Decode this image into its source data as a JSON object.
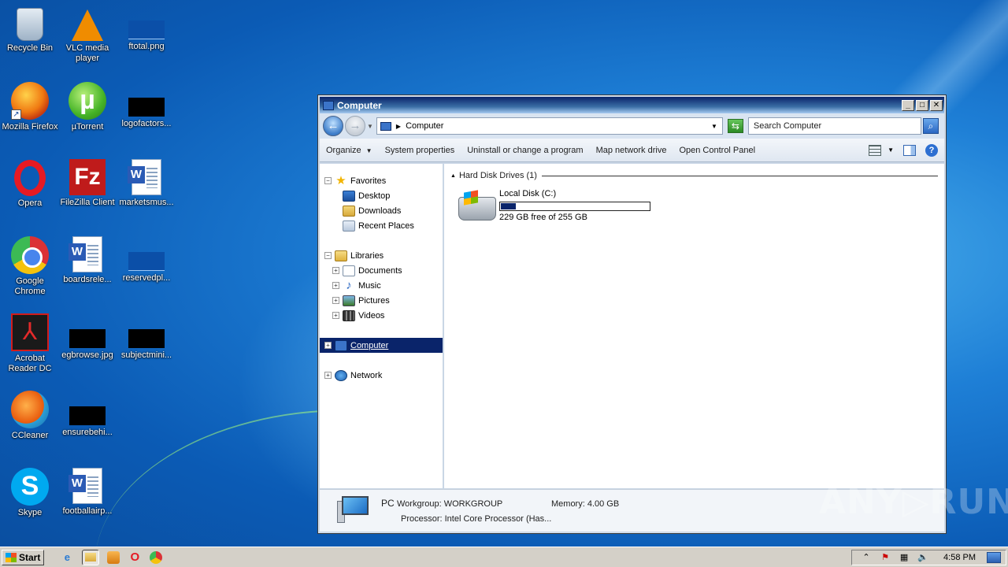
{
  "desktop": {
    "icons": [
      {
        "label": "Recycle Bin",
        "icon": "recycle-bin-icon"
      },
      {
        "label": "VLC media player",
        "icon": "vlc-icon"
      },
      {
        "label": "ftotal.png",
        "icon": "image-file-icon"
      },
      {
        "label": "Mozilla Firefox",
        "icon": "firefox-icon"
      },
      {
        "label": "µTorrent",
        "icon": "utorrent-icon"
      },
      {
        "label": "logofactors...",
        "icon": "image-file-icon"
      },
      {
        "label": "Opera",
        "icon": "opera-icon"
      },
      {
        "label": "FileZilla Client",
        "icon": "filezilla-icon"
      },
      {
        "label": "marketsmus...",
        "icon": "word-document-icon"
      },
      {
        "label": "Google Chrome",
        "icon": "chrome-icon"
      },
      {
        "label": "boardsrele...",
        "icon": "word-document-icon"
      },
      {
        "label": "reservedpl...",
        "icon": "image-file-icon"
      },
      {
        "label": "Acrobat Reader DC",
        "icon": "acrobat-icon"
      },
      {
        "label": "egbrowse.jpg",
        "icon": "image-file-icon"
      },
      {
        "label": "subjectmini...",
        "icon": "image-file-icon"
      },
      {
        "label": "CCleaner",
        "icon": "ccleaner-icon"
      },
      {
        "label": "ensurebehi...",
        "icon": "image-file-icon"
      },
      {
        "label": "Skype",
        "icon": "skype-icon"
      },
      {
        "label": "footballairp...",
        "icon": "word-document-icon"
      }
    ]
  },
  "window": {
    "title": "Computer",
    "buttons": {
      "minimize": "_",
      "maximize": "□",
      "close": "✕"
    },
    "address": {
      "crumb": "Computer"
    },
    "search": {
      "placeholder": "Search Computer"
    },
    "toolbar": {
      "organize": "Organize",
      "system_properties": "System properties",
      "uninstall": "Uninstall or change a program",
      "map_drive": "Map network drive",
      "control_panel": "Open Control Panel"
    },
    "nav": {
      "favorites": "Favorites",
      "desktop": "Desktop",
      "downloads": "Downloads",
      "recent": "Recent Places",
      "libraries": "Libraries",
      "documents": "Documents",
      "music": "Music",
      "pictures": "Pictures",
      "videos": "Videos",
      "computer": "Computer",
      "network": "Network"
    },
    "content": {
      "group_title": "Hard Disk Drives (1)",
      "drive_name": "Local Disk (C:)",
      "drive_free": "229 GB free of 255 GB",
      "drive_used_fraction": 0.102
    },
    "details": {
      "name": "PC",
      "workgroup": "Workgroup: WORKGROUP",
      "memory": "Memory: 4.00 GB",
      "processor": "Processor: Intel Core Processor (Has..."
    }
  },
  "watermark": "ANY▷RUN",
  "taskbar": {
    "start": "Start",
    "clock": "4:58 PM"
  }
}
